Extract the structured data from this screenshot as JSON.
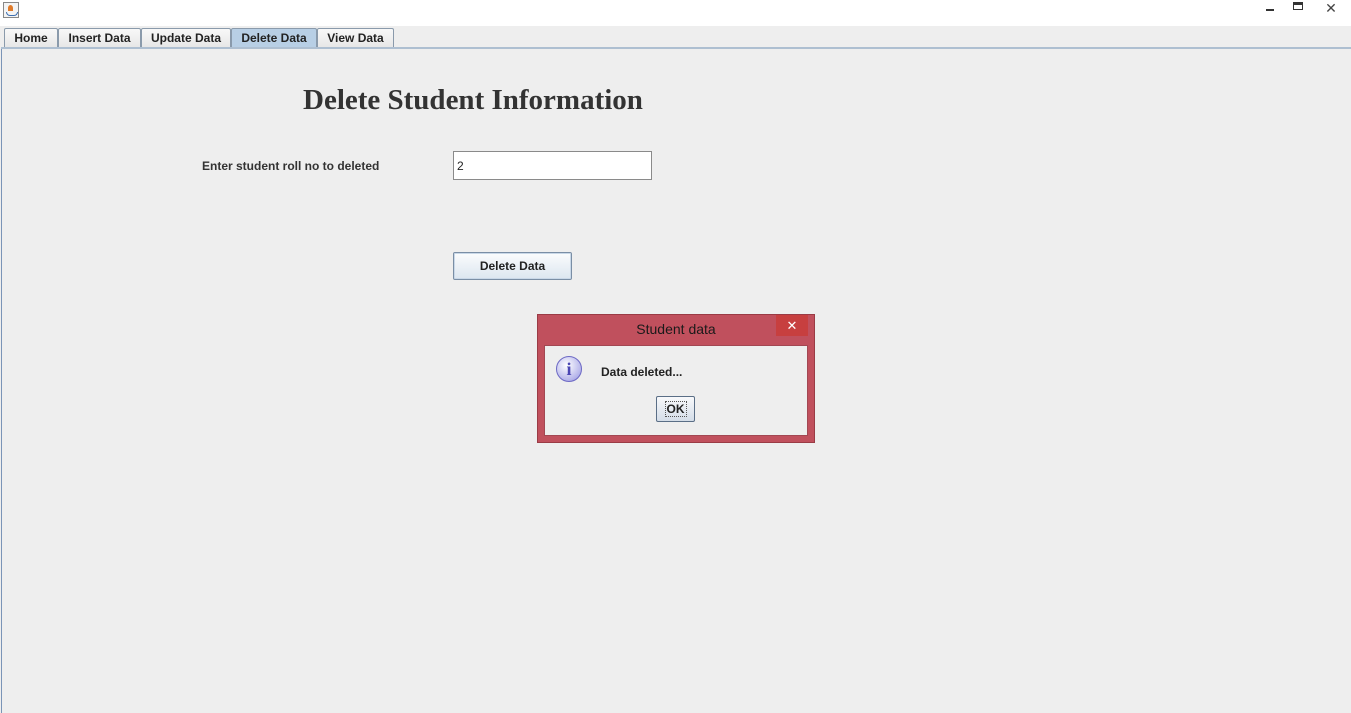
{
  "window": {
    "minimize_icon": "minimize-icon",
    "maximize_icon": "maximize-icon",
    "close_glyph": "✕"
  },
  "tabs": [
    {
      "label": "Home",
      "active": false
    },
    {
      "label": "Insert Data",
      "active": false
    },
    {
      "label": "Update Data",
      "active": false
    },
    {
      "label": "Delete Data",
      "active": true
    },
    {
      "label": "View Data",
      "active": false
    }
  ],
  "main": {
    "heading": "Delete Student Information",
    "field_label": "Enter student roll no to deleted",
    "roll_value": "2",
    "delete_button": "Delete Data"
  },
  "dialog": {
    "title": "Student data",
    "close_glyph": "✕",
    "icon": "info-icon",
    "icon_glyph": "i",
    "message": "Data deleted...",
    "ok_label": "OK"
  },
  "colors": {
    "dialog_frame": "#c0505d",
    "active_tab": "#b8cfe5",
    "background": "#eeeeee"
  }
}
